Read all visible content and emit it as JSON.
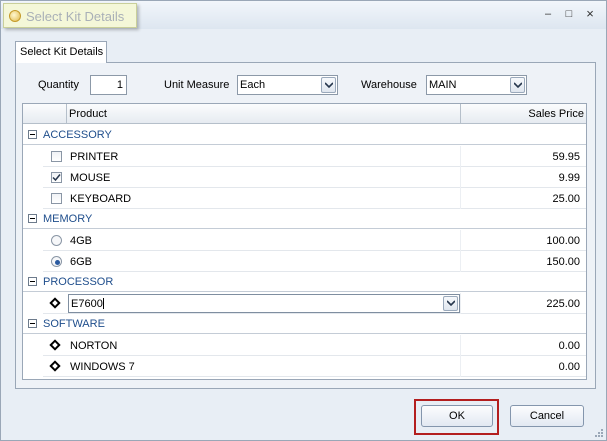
{
  "window": {
    "title": "Select Kit Details",
    "controls": {
      "close": "×",
      "minimize": "–",
      "maximize": "□"
    }
  },
  "tab": {
    "label": "Select Kit Details"
  },
  "form": {
    "quantity_label": "Quantity",
    "quantity_value": "1",
    "unit_label": "Unit Measure",
    "unit_value": "Each",
    "warehouse_label": "Warehouse",
    "warehouse_value": "MAIN"
  },
  "grid": {
    "columns": [
      "Product",
      "Sales Price"
    ],
    "groups": [
      {
        "name": "ACCESSORY",
        "selector": "checkbox",
        "items": [
          {
            "name": "PRINTER",
            "price": "59.95",
            "checked": false
          },
          {
            "name": "MOUSE",
            "price": "9.99",
            "checked": true
          },
          {
            "name": "KEYBOARD",
            "price": "25.00",
            "checked": false
          }
        ]
      },
      {
        "name": "MEMORY",
        "selector": "radio",
        "items": [
          {
            "name": "4GB",
            "price": "100.00",
            "checked": false
          },
          {
            "name": "6GB",
            "price": "150.00",
            "checked": true
          }
        ]
      },
      {
        "name": "PROCESSOR",
        "selector": "required",
        "items": [
          {
            "name": "E7600",
            "price": "225.00",
            "editing": true
          }
        ]
      },
      {
        "name": "SOFTWARE",
        "selector": "required",
        "items": [
          {
            "name": "NORTON",
            "price": "0.00"
          },
          {
            "name": "WINDOWS 7",
            "price": "0.00"
          }
        ]
      }
    ]
  },
  "buttons": {
    "ok": "OK",
    "cancel": "Cancel"
  },
  "colors": {
    "group_text": "#1f4e8c",
    "highlight_border": "#b31e1e",
    "window_bg": "#e8eef5"
  }
}
